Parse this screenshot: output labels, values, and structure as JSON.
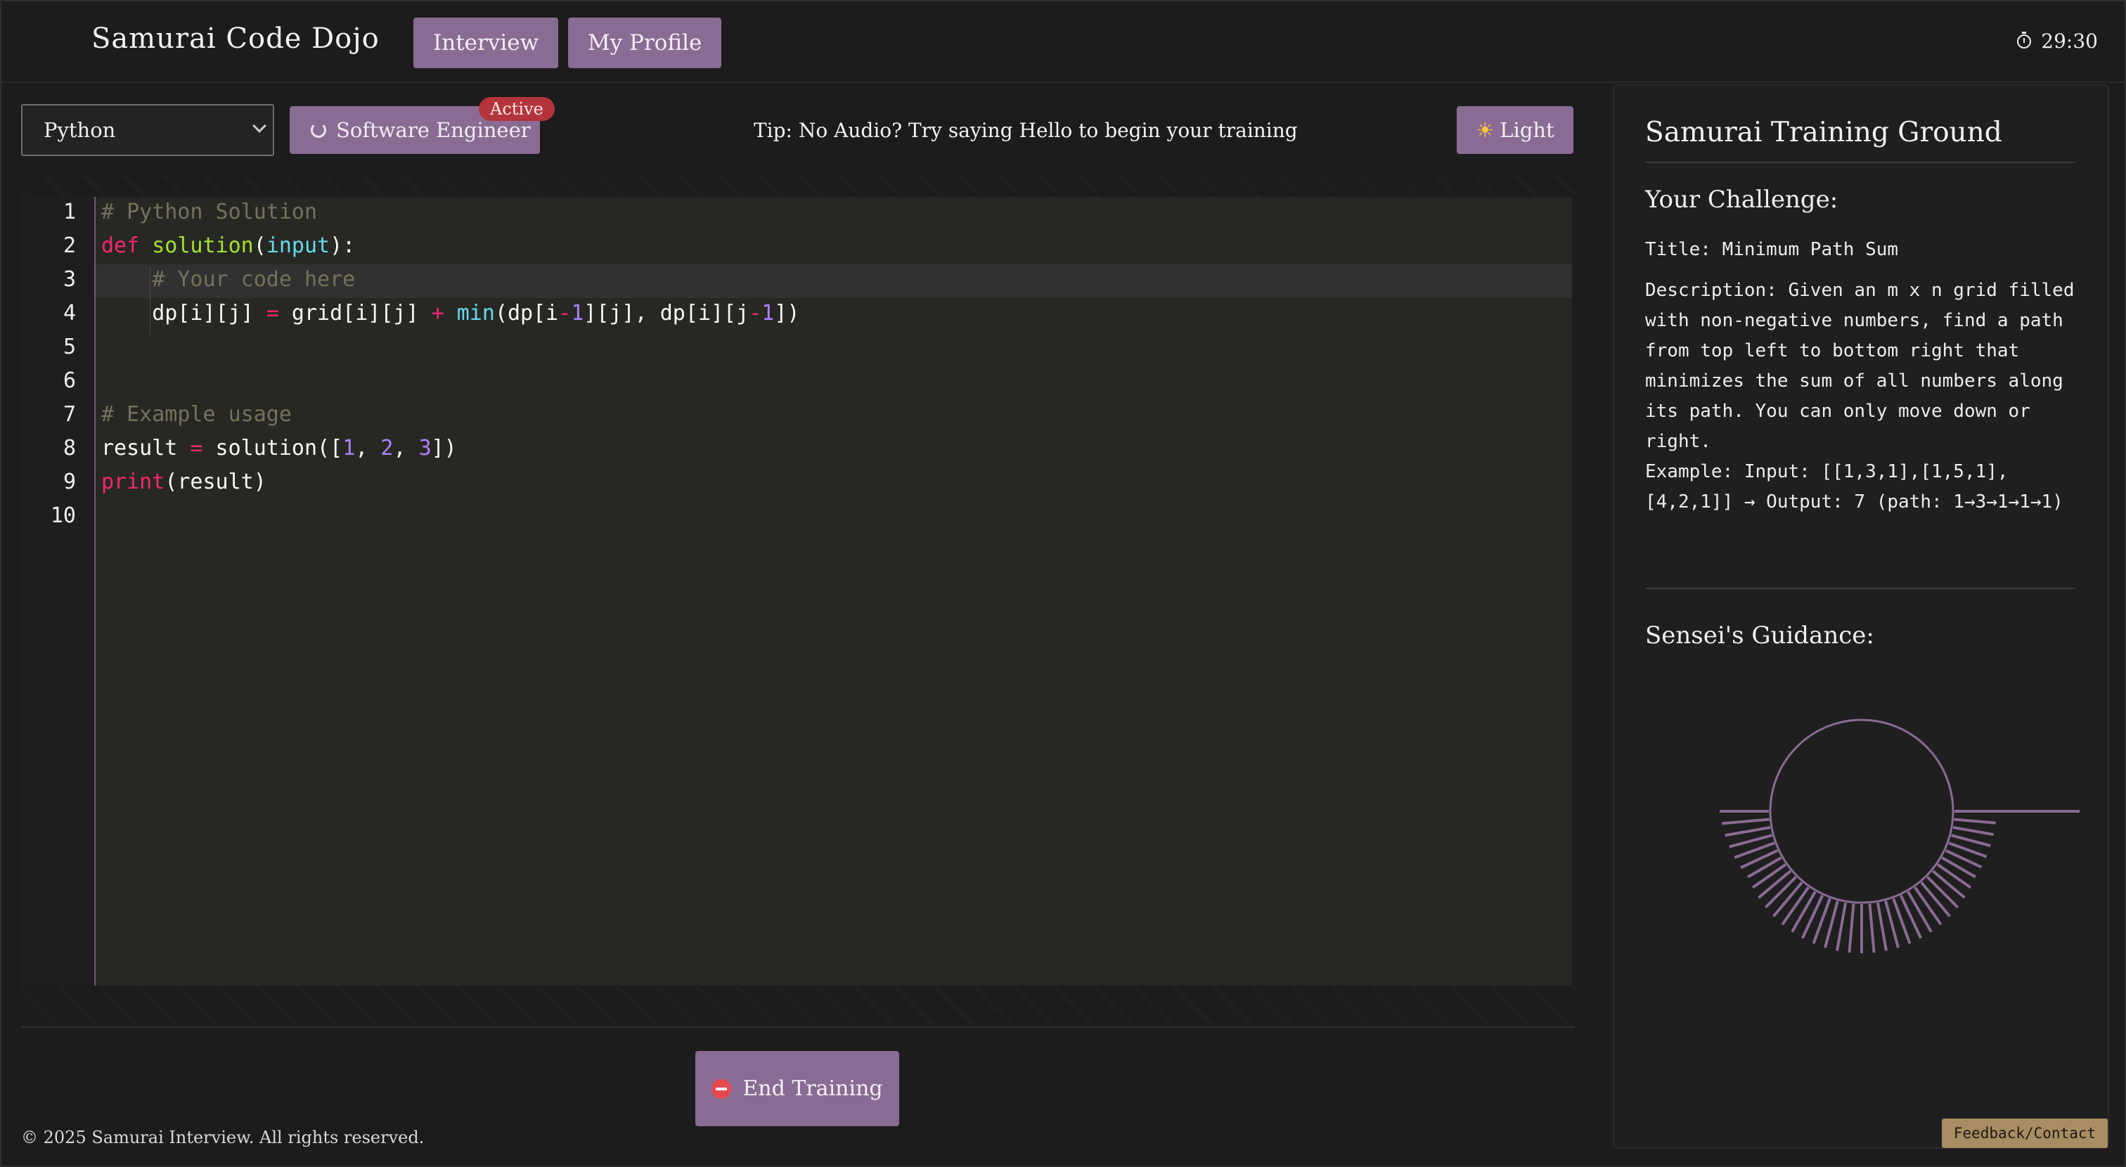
{
  "header": {
    "title": "Samurai Code Dojo",
    "nav": [
      {
        "label": "Interview"
      },
      {
        "label": "My Profile"
      }
    ],
    "timer": "29:30"
  },
  "toolbar": {
    "language": "Python",
    "role_label": "Software Engineer",
    "role_badge": "Active",
    "tip": "Tip: No Audio? Try saying Hello to begin your training",
    "theme_label": "Light"
  },
  "editor": {
    "line_numbers": [
      "1",
      "2",
      "3",
      "4",
      "5",
      "6",
      "7",
      "8",
      "9",
      "10"
    ],
    "lines": [
      "# Python Solution",
      "def solution(input):",
      "    # Your code here",
      "    dp[i][j] = grid[i][j] + min(dp[i-1][j], dp[i][j-1])",
      "",
      "",
      "# Example usage",
      "result = solution([1, 2, 3])",
      "print(result)",
      ""
    ]
  },
  "footer": {
    "end_button": "End Training",
    "copyright": "© 2025 Samurai Interview. All rights reserved."
  },
  "panel": {
    "title": "Samurai Training Ground",
    "challenge_heading": "Your Challenge:",
    "challenge_title": "Title: Minimum Path Sum",
    "challenge_description": "Description: Given an m x n grid filled with non-negative numbers, find a path from top left to bottom right that minimizes the sum of all numbers along its path. You can only move down or right.",
    "challenge_example": "Example: Input: [[1,3,1],[1,5,1],[4,2,1]] → Output: 7 (path: 1→3→1→1→1)",
    "guidance_heading": "Sensei's Guidance:",
    "feedback_button": "Feedback/Contact"
  },
  "colors": {
    "accent": "#8a6b93",
    "badge": "#b3343b",
    "feedback": "#a88c63"
  }
}
